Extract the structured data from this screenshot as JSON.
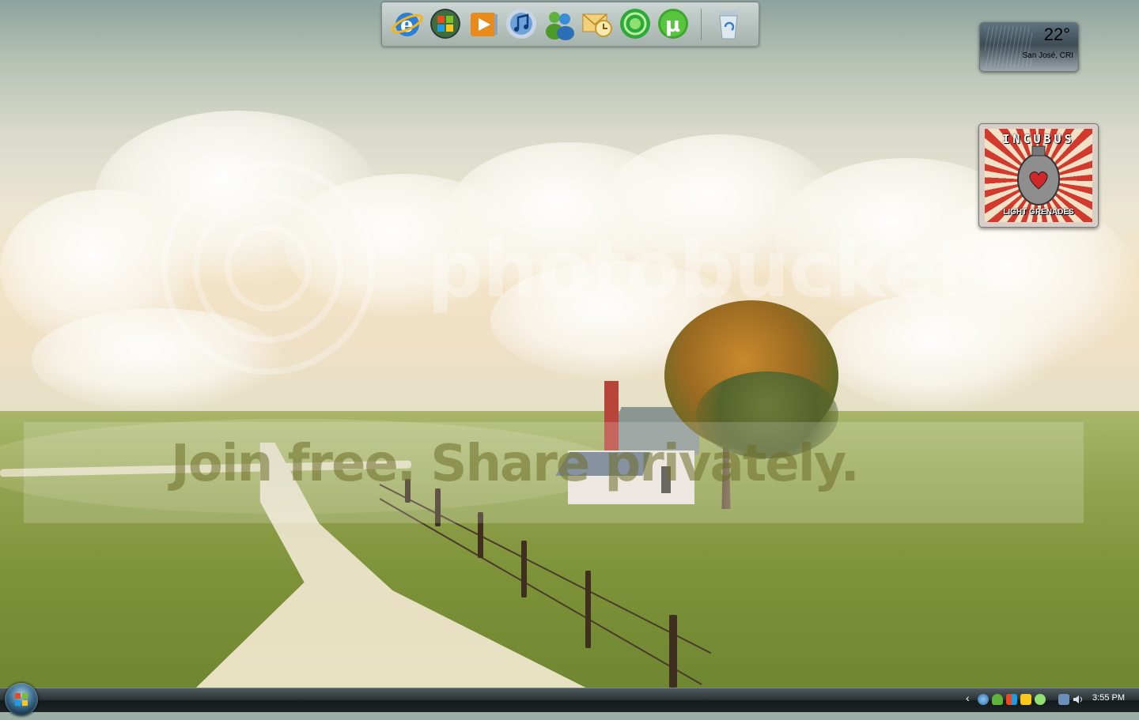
{
  "dock": {
    "items": [
      {
        "name": "Internet Explorer",
        "icon": "internet-explorer-icon"
      },
      {
        "name": "Windows",
        "icon": "windows-flag-icon"
      },
      {
        "name": "Media Player",
        "icon": "media-player-icon"
      },
      {
        "name": "iTunes",
        "icon": "itunes-icon"
      },
      {
        "name": "Messenger",
        "icon": "messenger-icon"
      },
      {
        "name": "Mail",
        "icon": "mail-icon"
      },
      {
        "name": "Green Circle App",
        "icon": "green-circle-icon"
      },
      {
        "name": "uTorrent",
        "icon": "utorrent-icon"
      },
      {
        "name": "Recycle Bin",
        "icon": "recycle-bin-icon"
      }
    ],
    "utorrent_glyph": "µ"
  },
  "weather": {
    "temperature": "22°",
    "location": "San José, CRI"
  },
  "album": {
    "title": "INCUBUS",
    "subtitle": "LIGHT GRENADES"
  },
  "watermark": {
    "brand": "photobucket",
    "slogan": "Join free. Share privately."
  },
  "taskbar": {
    "start_icon": "windows-start-orb-icon",
    "tray_chevron": "‹",
    "clock": "3:55 PM",
    "tray_icons": [
      "network-globe-icon",
      "people-icon",
      "security-shield-icon",
      "update-icon",
      "messenger-tray-icon",
      "network-icon",
      "volume-icon"
    ]
  },
  "colors": {
    "taskbar": "#1c2426",
    "sky": "#d9dacb",
    "grass": "#7d9238",
    "album_red": "#d23a2e"
  }
}
